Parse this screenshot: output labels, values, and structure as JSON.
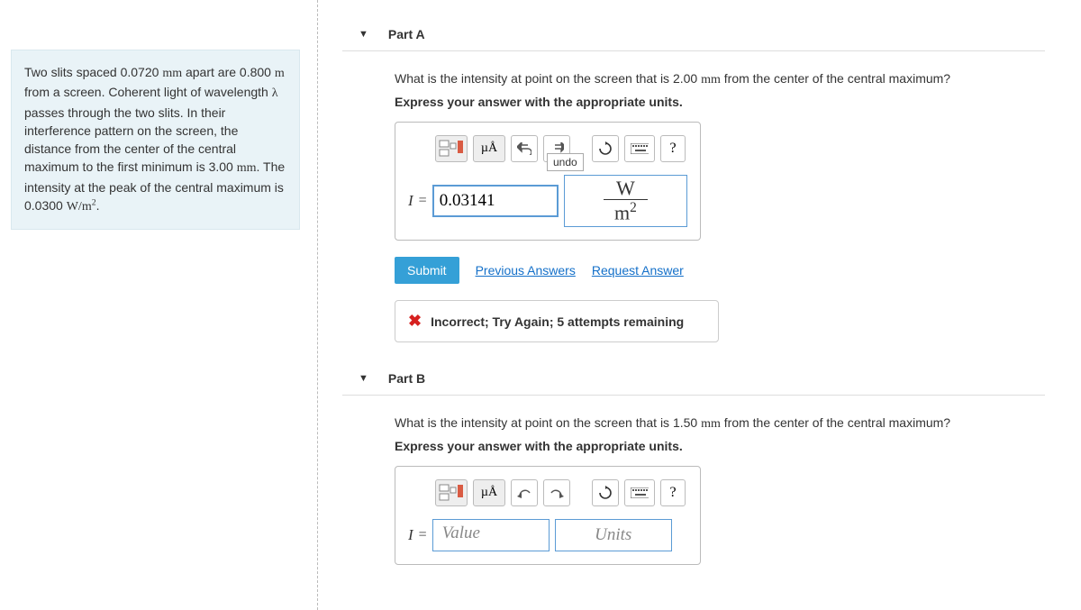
{
  "problem": {
    "text_parts": {
      "p1a": "Two slits spaced 0.0720 ",
      "p1b": " apart are 0.800 ",
      "p1c": " from a screen. Coherent light of wavelength ",
      "p1d": " passes through the two slits. In their interference pattern on the screen, the distance from the center of the central maximum to the first minimum is 3.00 ",
      "p1e": ". The intensity at the peak of the central maximum is 0.0300 ",
      "p1f": ".",
      "mm": "mm",
      "m": "m",
      "lambda": "λ",
      "Wm2_a": "W/m",
      "Wm2_sup": "2"
    }
  },
  "partA": {
    "title": "Part A",
    "prompt_a": "What is the intensity at point on the screen that is 2.00 ",
    "prompt_mm": "mm",
    "prompt_b": " from the center of the central maximum?",
    "hint": "Express your answer with the appropriate units.",
    "toolbar": {
      "units_label": "µÅ",
      "undo_tip": "undo",
      "help": "?"
    },
    "var": "I",
    "eq": "=",
    "value": "0.03141",
    "unit_num": "W",
    "unit_den_a": "m",
    "unit_den_sup": "2",
    "submit": "Submit",
    "prev": "Previous Answers",
    "req": "Request Answer",
    "feedback": "Incorrect; Try Again; 5 attempts remaining"
  },
  "partB": {
    "title": "Part B",
    "prompt_a": "What is the intensity at point on the screen that is 1.50 ",
    "prompt_mm": "mm",
    "prompt_b": " from the center of the central maximum?",
    "hint": "Express your answer with the appropriate units.",
    "var": "I",
    "eq": "=",
    "value_placeholder": "Value",
    "units_placeholder": "Units",
    "toolbar": {
      "units_label": "µÅ",
      "help": "?"
    }
  }
}
